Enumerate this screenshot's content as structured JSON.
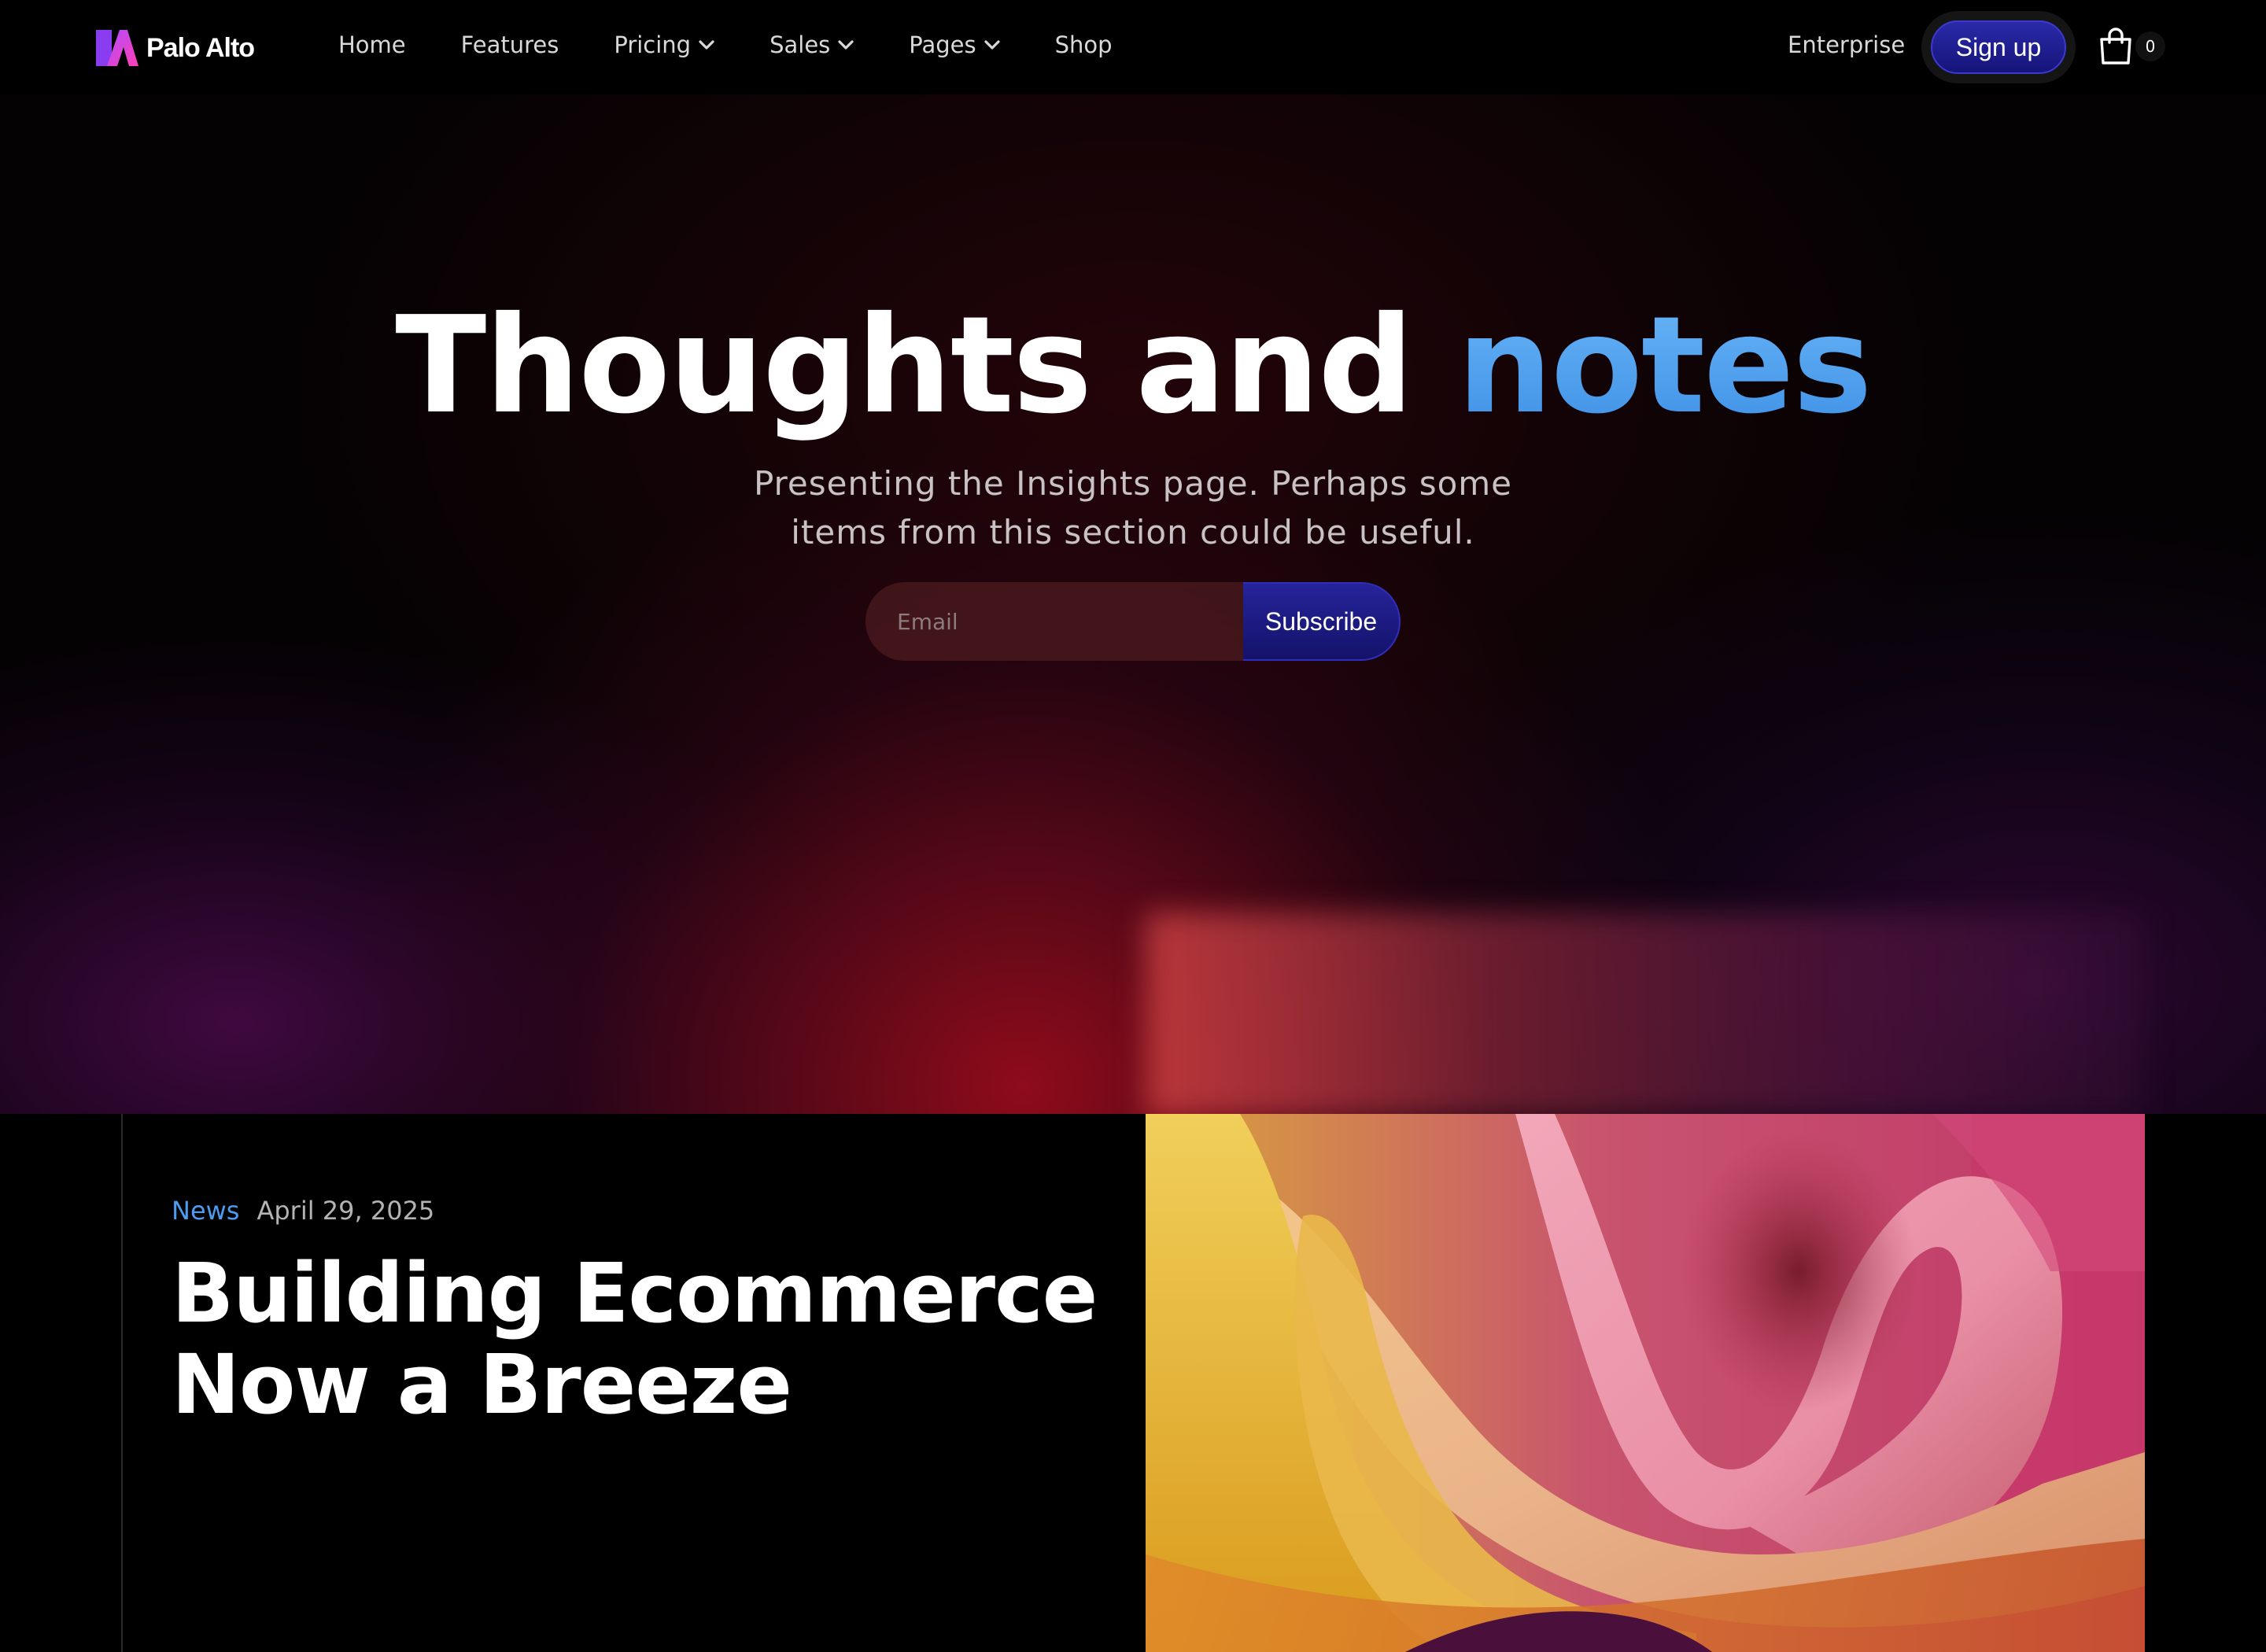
{
  "brand": {
    "name": "Palo Alto"
  },
  "nav": {
    "items": [
      {
        "label": "Home",
        "has_dropdown": false
      },
      {
        "label": "Features",
        "has_dropdown": false
      },
      {
        "label": "Pricing",
        "has_dropdown": true
      },
      {
        "label": "Sales",
        "has_dropdown": true
      },
      {
        "label": "Pages",
        "has_dropdown": true
      },
      {
        "label": "Shop",
        "has_dropdown": false
      }
    ],
    "enterprise": "Enterprise",
    "signup": "Sign up",
    "cart_count": "0"
  },
  "hero": {
    "title_main": "Thoughts and",
    "title_accent": "notes",
    "subtitle_line1": "Presenting the Insights page. Perhaps some",
    "subtitle_line2": "items from this section could be useful.",
    "email_placeholder": "Email",
    "subscribe_label": "Subscribe"
  },
  "article": {
    "tag": "News",
    "date": "April 29, 2025",
    "title_line1": "Building Ecommerce",
    "title_line2": "Now a Breeze"
  },
  "colors": {
    "accent_blue": "#4c9cf0",
    "button_indigo": "#1f1d8c",
    "background": "#000000"
  },
  "icons": {
    "logo": "palo-alto-logo-icon",
    "chevron": "chevron-down-icon",
    "cart": "shopping-bag-icon"
  }
}
